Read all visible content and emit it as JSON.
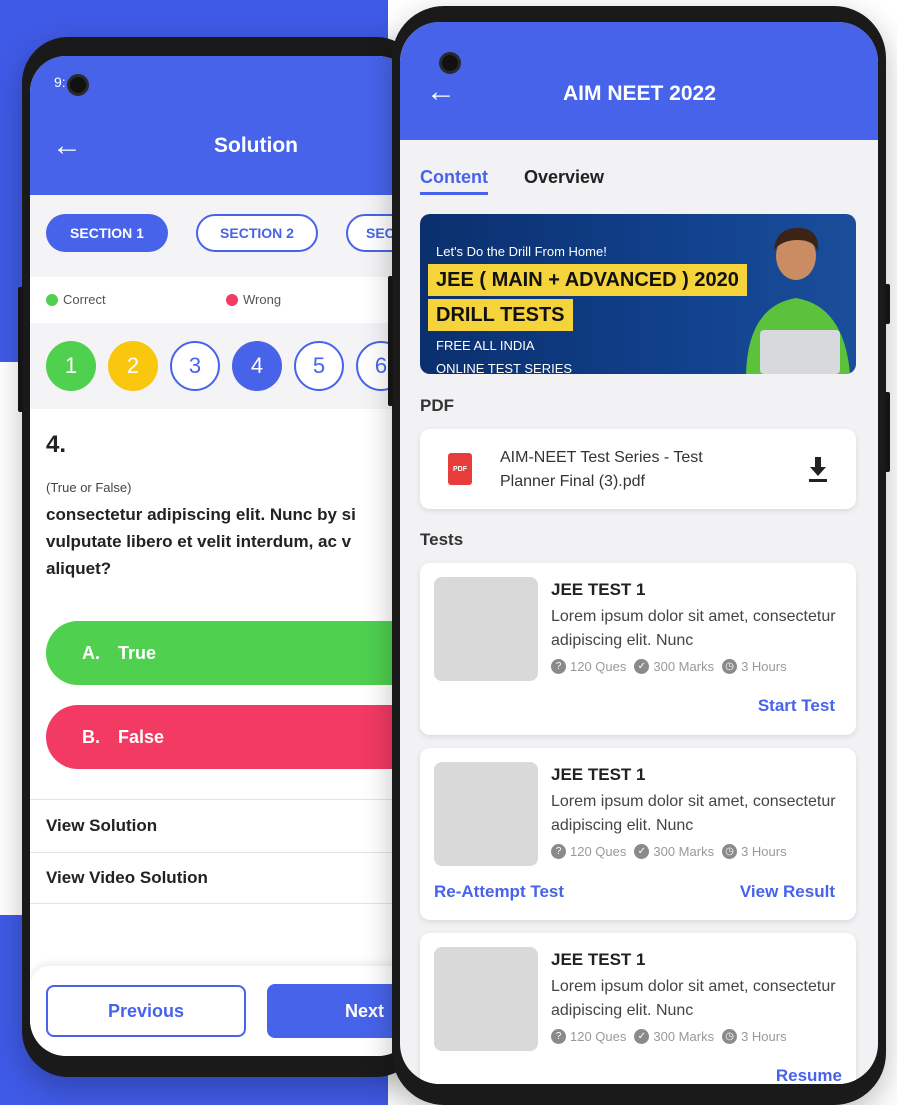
{
  "colors": {
    "brand": "#4763ea",
    "correct": "#4fd04f",
    "wrong": "#f23a62",
    "yellow": "#f9c80e"
  },
  "left_phone": {
    "status_time": "9:",
    "header_title": "Solution",
    "sections": [
      "SECTION 1",
      "SECTION 2",
      "SEC"
    ],
    "legend": {
      "correct": "Correct",
      "wrong": "Wrong"
    },
    "question_numbers": [
      "1",
      "2",
      "3",
      "4",
      "5",
      "6"
    ],
    "question": {
      "number": "4.",
      "type": "(True or False)",
      "text": "consectetur adipiscing elit. Nunc by si vulputate libero et velit interdum, ac v aliquet?"
    },
    "options": [
      {
        "letter": "A.",
        "label": "True"
      },
      {
        "letter": "B.",
        "label": "False"
      }
    ],
    "links": [
      "View Solution",
      "View Video Solution"
    ],
    "footer": {
      "previous": "Previous",
      "next": "Next"
    }
  },
  "right_phone": {
    "header_title": "AIM NEET 2022",
    "tabs": [
      "Content",
      "Overview"
    ],
    "banner": {
      "tagline": "Let's Do the Drill From Home!",
      "headline_1": "JEE ( MAIN + ADVANCED ) 2020",
      "headline_2": "DRILL TESTS",
      "line_1": "FREE ALL INDIA",
      "line_2": "ONLINE TEST SERIES"
    },
    "pdf_label": "PDF",
    "pdf_file": "AIM-NEET Test Series - Test Planner Final (3).pdf",
    "pdf_icon_text": "PDF",
    "tests_label": "Tests",
    "tests": [
      {
        "title": "JEE TEST 1",
        "desc": "Lorem ipsum dolor sit amet, consectetur adipiscing elit. Nunc",
        "ques": "120 Ques",
        "marks": "300 Marks",
        "hours": "3 Hours",
        "action_left": "",
        "action_right": "Start Test"
      },
      {
        "title": "JEE TEST 1",
        "desc": "Lorem ipsum dolor sit amet, consectetur adipiscing elit. Nunc",
        "ques": "120 Ques",
        "marks": "300 Marks",
        "hours": "3 Hours",
        "action_left": "Re-Attempt Test",
        "action_right": "View Result"
      },
      {
        "title": "JEE TEST 1",
        "desc": "Lorem ipsum dolor sit amet, consectetur adipiscing elit. Nunc",
        "ques": "120 Ques",
        "marks": "300 Marks",
        "hours": "3 Hours",
        "action_left": "",
        "action_right": "Resume"
      }
    ]
  }
}
